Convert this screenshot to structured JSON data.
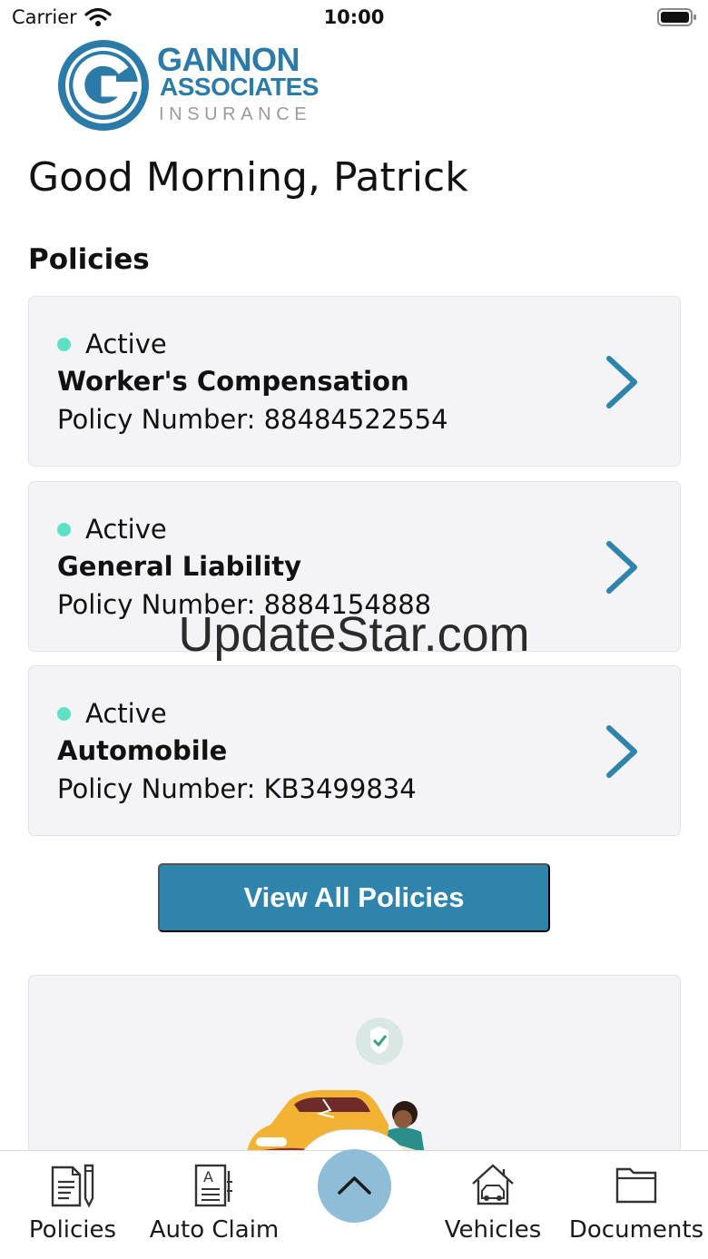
{
  "status_bar": {
    "carrier": "Carrier",
    "time": "10:00"
  },
  "logo": {
    "line1": "GANNON",
    "line2": "ASSOCIATES",
    "line3": "INSURANCE"
  },
  "greeting": "Good Morning, Patrick",
  "policies_section": {
    "title": "Policies",
    "items": [
      {
        "status": "Active",
        "name": "Worker's Compensation",
        "number": "Policy Number: 88484522554"
      },
      {
        "status": "Active",
        "name": "General Liability",
        "number": "Policy Number: 8884154888"
      },
      {
        "status": "Active",
        "name": "Automobile",
        "number": "Policy Number: KB3499834"
      }
    ],
    "view_all_label": "View All Policies"
  },
  "watermark": "UpdateStar.com",
  "tab_bar": {
    "tabs": [
      {
        "label": "Policies",
        "icon": "policy-document-pen-icon"
      },
      {
        "label": "Auto Claim",
        "icon": "claim-form-icon"
      },
      {
        "label": "",
        "icon": "chevron-up-icon"
      },
      {
        "label": "Vehicles",
        "icon": "house-car-icon"
      },
      {
        "label": "Documents",
        "icon": "folder-icon"
      }
    ]
  },
  "colors": {
    "brand": "#2b7aa8",
    "button": "#2f84ae",
    "active_dot": "#5ee0c4",
    "card_bg": "#f4f4f6",
    "center_button": "#8fbcd6"
  }
}
